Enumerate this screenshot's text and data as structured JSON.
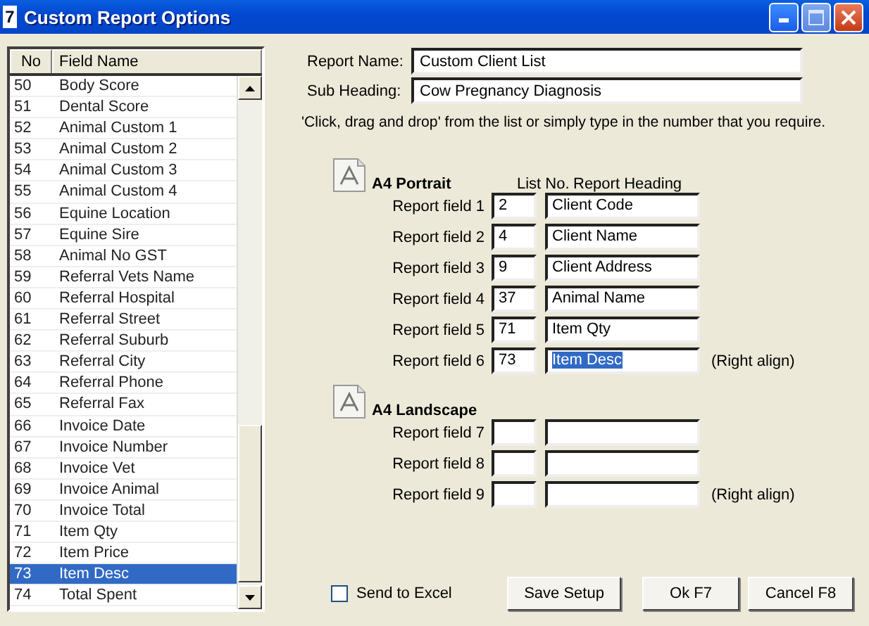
{
  "window": {
    "title": "Custom Report Options",
    "icon_text": "7"
  },
  "field_list": {
    "columns": [
      "No",
      "Field Name"
    ],
    "rows": [
      {
        "no": "50",
        "name": "Body Score",
        "selected": false
      },
      {
        "no": "51",
        "name": "Dental Score",
        "selected": false
      },
      {
        "no": "52",
        "name": "Animal Custom 1",
        "selected": false
      },
      {
        "no": "53",
        "name": "Animal Custom 2",
        "selected": false
      },
      {
        "no": "54",
        "name": "Animal Custom 3",
        "selected": false
      },
      {
        "no": "55",
        "name": "Animal Custom 4",
        "selected": false
      },
      {
        "no": "56",
        "name": "Equine Location",
        "selected": false
      },
      {
        "no": "57",
        "name": "Equine Sire",
        "selected": false
      },
      {
        "no": "58",
        "name": "Animal No GST",
        "selected": false
      },
      {
        "no": "59",
        "name": "Referral Vets Name",
        "selected": false
      },
      {
        "no": "60",
        "name": "Referral Hospital",
        "selected": false
      },
      {
        "no": "61",
        "name": "Referral Street",
        "selected": false
      },
      {
        "no": "62",
        "name": "Referral Suburb",
        "selected": false
      },
      {
        "no": "63",
        "name": "Referral City",
        "selected": false
      },
      {
        "no": "64",
        "name": "Referral Phone",
        "selected": false
      },
      {
        "no": "65",
        "name": "Referral Fax",
        "selected": false
      },
      {
        "no": "66",
        "name": "Invoice Date",
        "selected": false
      },
      {
        "no": "67",
        "name": "Invoice Number",
        "selected": false
      },
      {
        "no": "68",
        "name": "Invoice Vet",
        "selected": false
      },
      {
        "no": "69",
        "name": "Invoice Animal",
        "selected": false
      },
      {
        "no": "70",
        "name": "Invoice Total",
        "selected": false
      },
      {
        "no": "71",
        "name": "Item Qty",
        "selected": false
      },
      {
        "no": "72",
        "name": "Item Price",
        "selected": false
      },
      {
        "no": "73",
        "name": "Item Desc",
        "selected": true
      },
      {
        "no": "74",
        "name": "Total Spent",
        "selected": false
      }
    ]
  },
  "report_name": {
    "label": "Report Name:",
    "value": "Custom Client List"
  },
  "sub_heading": {
    "label": "Sub Heading:",
    "value": "Cow Pregnancy Diagnosis"
  },
  "instructions": "'Click, drag and drop' from the list or simply type in the number that you require.",
  "sections": [
    {
      "title": "A4 Portrait",
      "list_no_header": "List No.",
      "heading_header": "Report Heading",
      "fields": [
        {
          "label": "Report field 1",
          "list_no": "2",
          "heading": "Client Code",
          "text_selected": false
        },
        {
          "label": "Report field 2",
          "list_no": "4",
          "heading": "Client Name",
          "text_selected": false
        },
        {
          "label": "Report field 3",
          "list_no": "9",
          "heading": "Client Address",
          "text_selected": false
        },
        {
          "label": "Report field 4",
          "list_no": "37",
          "heading": "Animal Name",
          "text_selected": false
        },
        {
          "label": "Report field 5",
          "list_no": "71",
          "heading": "Item Qty",
          "text_selected": false
        },
        {
          "label": "Report field 6",
          "list_no": "73",
          "heading": "Item Desc",
          "text_selected": true,
          "note": "(Right align)"
        }
      ]
    },
    {
      "title": "A4 Landscape",
      "fields": [
        {
          "label": "Report field 7"
        },
        {
          "label": "Report field 8"
        },
        {
          "label": "Report field 9",
          "note": "(Right align)"
        }
      ]
    }
  ],
  "send_to_excel": {
    "label": "Send to Excel",
    "checked": false
  },
  "buttons": [
    "Save Setup",
    "Ok F7",
    "Cancel F8"
  ]
}
